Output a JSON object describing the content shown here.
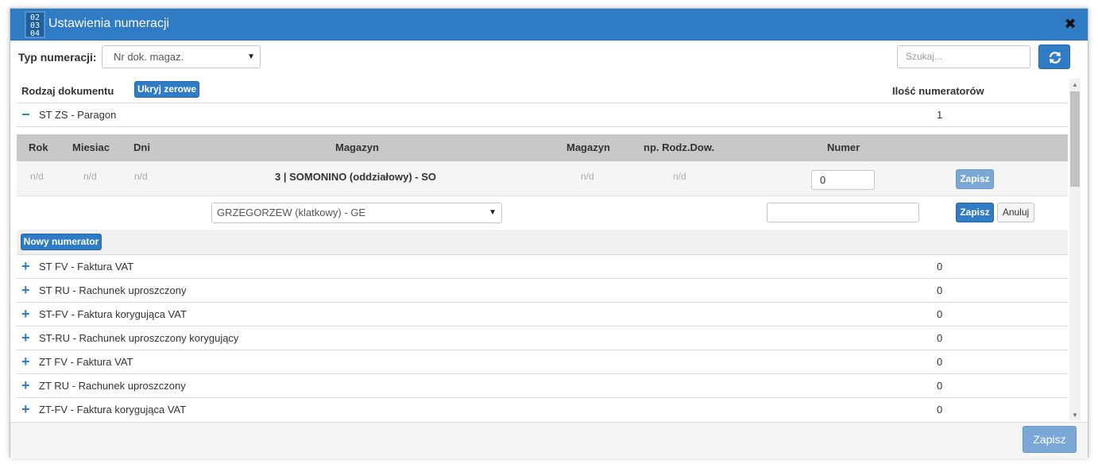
{
  "window": {
    "title": "Ustawienia numeracji",
    "icon": "calendar-numbers-icon",
    "close_icon": "close-icon"
  },
  "toolbar": {
    "typ_label": "Typ numeracji:",
    "typ_value": "Nr dok. magaz.",
    "search_placeholder": "Szukaj...",
    "refresh_icon": "refresh-icon"
  },
  "table": {
    "col_rodzaj": "Rodzaj dokumentu",
    "hide_zero_label": "Ukryj zerowe",
    "col_ilosc": "Ilość numeratorów",
    "expanded": {
      "name": "ST ZS - Paragon",
      "count": "1",
      "toggle": "−",
      "sub_headers": [
        "Rok",
        "Miesiac",
        "Dni",
        "Magazyn",
        "Magazyn",
        "np. Rodz.Dow.",
        "Numer"
      ],
      "row": {
        "rok": "n/d",
        "miesiac": "n/d",
        "dni": "n/d",
        "magazyn": "3 | SOMONINO (oddziałowy) - SO",
        "magazyn2": "n/d",
        "rodz_dow": "n/d",
        "numer": "0",
        "save_label": "Zapisz"
      },
      "edit": {
        "magazyn_select": "GRZEGORZEW (klatkowy) - GE",
        "save_label": "Zapisz",
        "cancel_label": "Anuluj"
      },
      "new_label": "Nowy numerator"
    },
    "rows": [
      {
        "toggle": "+",
        "name": "ST FV - Faktura VAT",
        "count": "0"
      },
      {
        "toggle": "+",
        "name": "ST RU - Rachunek uproszczony",
        "count": "0"
      },
      {
        "toggle": "+",
        "name": "ST-FV - Faktura korygująca VAT",
        "count": "0"
      },
      {
        "toggle": "+",
        "name": "ST-RU - Rachunek uproszczony korygujący",
        "count": "0"
      },
      {
        "toggle": "+",
        "name": "ZT FV - Faktura VAT",
        "count": "0"
      },
      {
        "toggle": "+",
        "name": "ZT RU - Rachunek uproszczony",
        "count": "0"
      },
      {
        "toggle": "+",
        "name": "ZT-FV - Faktura korygująca VAT",
        "count": "0"
      }
    ]
  },
  "footer": {
    "save_label": "Zapisz"
  },
  "colors": {
    "accent": "#2f7cc4",
    "disabled_accent": "#7aa7d6",
    "subheader_bg": "#c8c8c8"
  }
}
